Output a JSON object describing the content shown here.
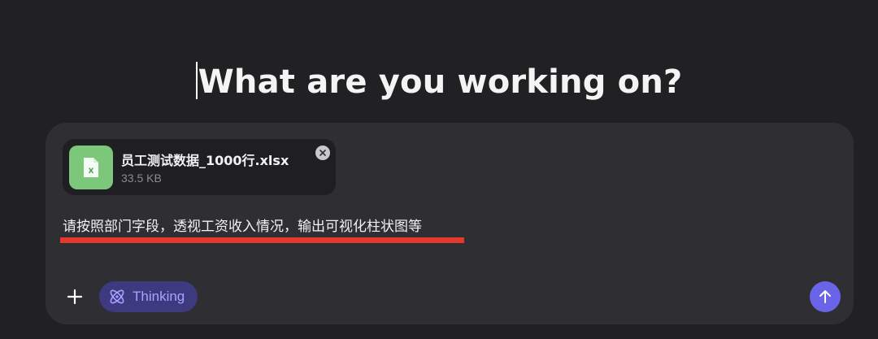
{
  "heading": {
    "text": "What are you working on?"
  },
  "attachment": {
    "name": "员工测试数据_1000行.xlsx",
    "size": "33.5 KB",
    "thumb_glyph": "X",
    "thumb_color": "#7cc77a",
    "icon": "spreadsheet-file-icon",
    "remove_icon": "close-icon"
  },
  "prompt": {
    "text": "请按照部门字段，透视工资收入情况，输出可视化柱状图等",
    "highlight_color": "#e5392e"
  },
  "toolbar": {
    "add_icon": "plus-icon",
    "thinking_label": "Thinking",
    "thinking_icon": "atom-icon",
    "send_icon": "arrow-up-icon",
    "accent_color": "#6a64e8"
  }
}
